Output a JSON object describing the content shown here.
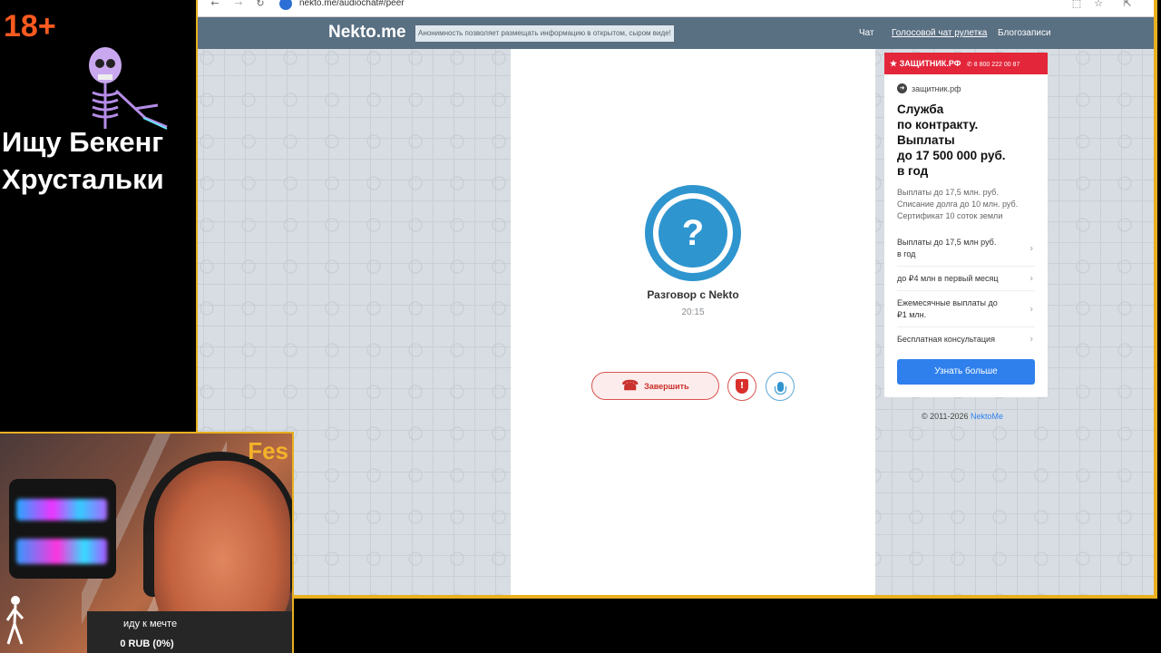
{
  "overlay": {
    "age_badge": "18+",
    "text_line1": "Ищу Бекенг",
    "text_line2": "Хрустальки"
  },
  "webcam": {
    "label": "Fes",
    "caption": "иду к мечте",
    "donation": "0 RUB (0%)"
  },
  "browser": {
    "url": "nekto.me/audiochat#/peer"
  },
  "site": {
    "logo": "Nekto.me",
    "notice": "Анонимность позволяет размещать информацию в открытом, сыром виде!",
    "nav": [
      "Чат",
      "Голосовой чат рулетка",
      "Блогозаписи"
    ]
  },
  "call": {
    "avatar_symbol": "?",
    "title": "Разговор с Nekto",
    "timer": "20:15",
    "end_label": "Завершить"
  },
  "ad": {
    "banner": "ЗАЩИТНИК.РФ",
    "banner_phone": "8 800 222 00 87",
    "source": "защитник.рф",
    "headline": "Служба\nпо контракту.\nВыплаты\nдо 17 500 000 руб.\nв год",
    "description": "Выплаты до 17,5 млн. руб.\nСписание долга до 10 млн. руб.\nСертификат 10 соток земли",
    "links": [
      "Выплаты до 17,5 млн руб.\nв год",
      "до ₽4 млн в первый месяц",
      "Ежемесячные выплаты до\n₽1 млн.",
      "Бесплатная консультация"
    ],
    "cta": "Узнать больше"
  },
  "footer": {
    "copyright": "© 2011-2026",
    "brand": "NektoMe"
  },
  "colors": {
    "accent_blue": "#2f95cf",
    "header_bg": "#596f82",
    "danger_red": "#d9534f",
    "frame_gold": "#e8b020",
    "overlay_orange": "#ff5a1f"
  }
}
